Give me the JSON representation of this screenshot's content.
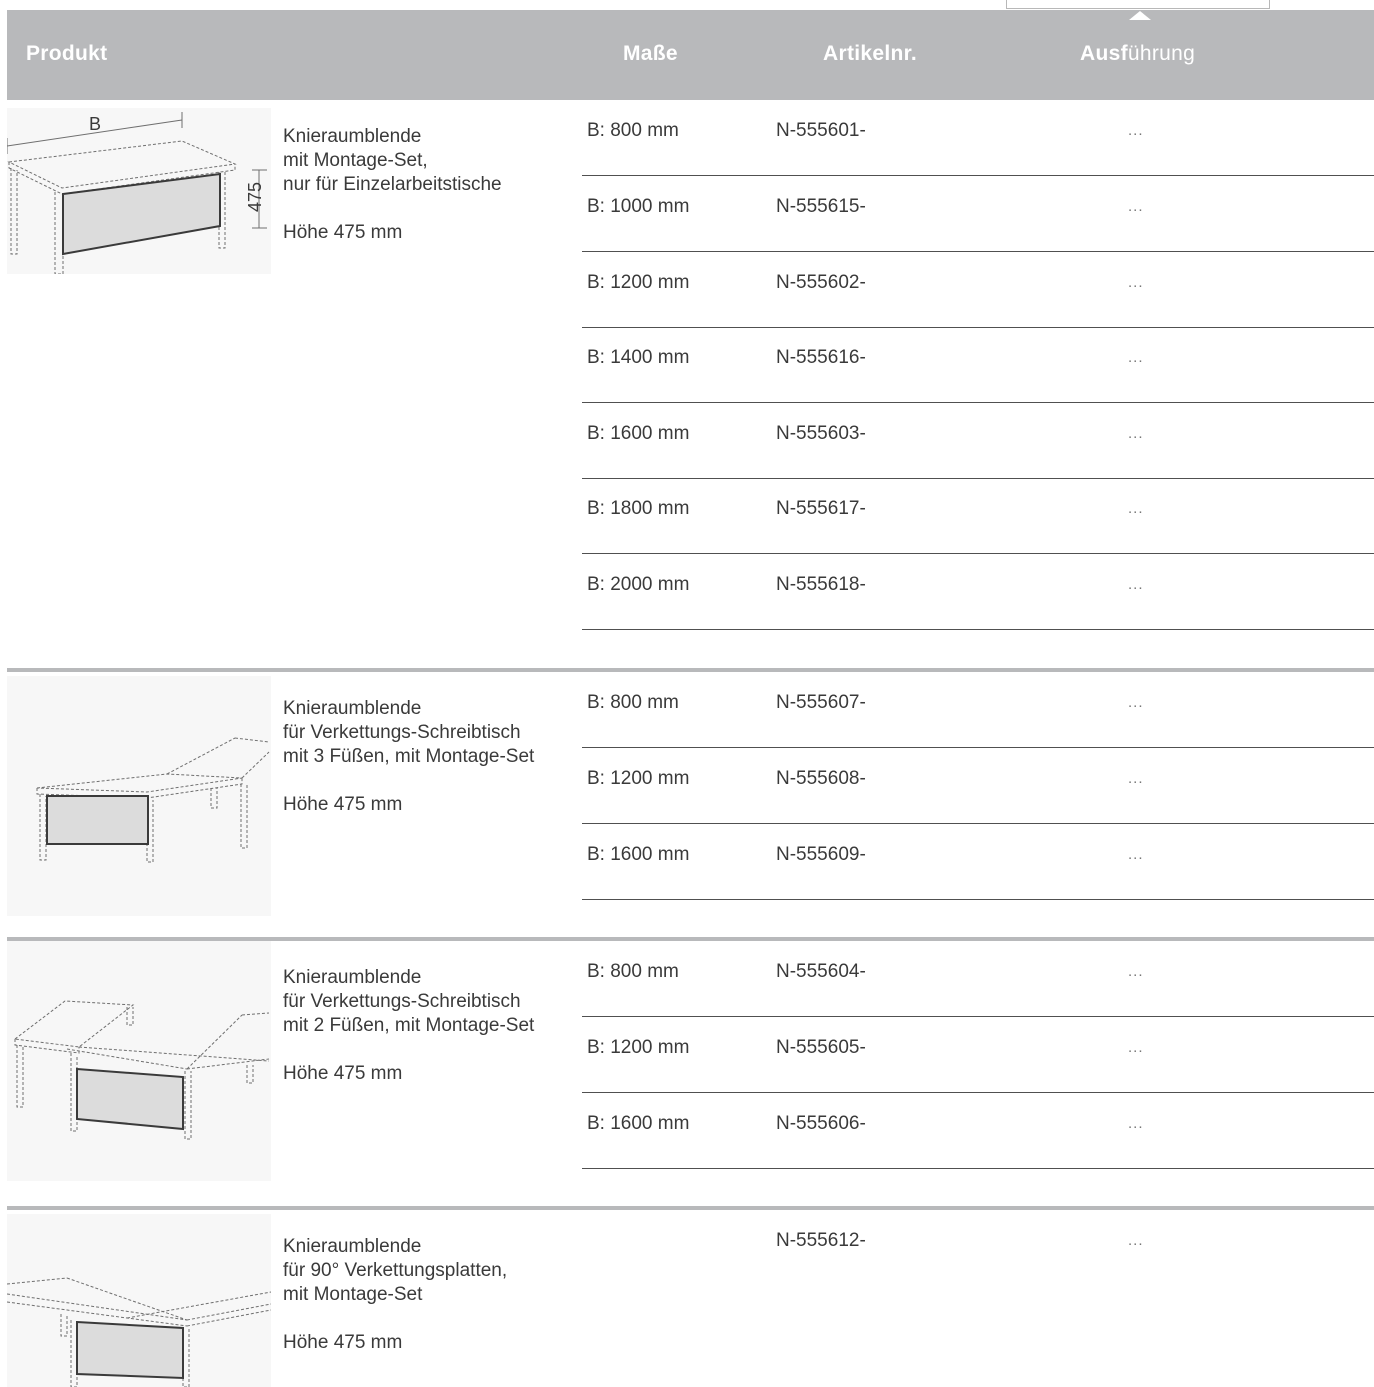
{
  "header": {
    "produkt": "Produkt",
    "masse": "Maße",
    "artikelnr": "Artikelnr.",
    "ausfuehrung_bold": "Ausf",
    "ausfuehrung_light": "ührung"
  },
  "colors": {
    "header_bg": "#b8b9bb",
    "panel_fill": "#dcdcdc",
    "divider": "#505050"
  },
  "sections": [
    {
      "desc": [
        "Knieraumblende",
        "mit Montage-Set,",
        "nur für Einzelarbeitstische",
        "",
        "Höhe 475 mm"
      ],
      "dim_width_label": "B",
      "dim_height_label": "475",
      "rows": [
        {
          "masse": "B: 800 mm",
          "artikel": "N-555601-",
          "ausf": "..."
        },
        {
          "masse": "B: 1000 mm",
          "artikel": "N-555615-",
          "ausf": "..."
        },
        {
          "masse": "B: 1200 mm",
          "artikel": "N-555602-",
          "ausf": "..."
        },
        {
          "masse": "B: 1400 mm",
          "artikel": "N-555616-",
          "ausf": "..."
        },
        {
          "masse": "B: 1600 mm",
          "artikel": "N-555603-",
          "ausf": "..."
        },
        {
          "masse": "B: 1800 mm",
          "artikel": "N-555617-",
          "ausf": "..."
        },
        {
          "masse": "B: 2000 mm",
          "artikel": "N-555618-",
          "ausf": "..."
        }
      ]
    },
    {
      "desc": [
        "Knieraumblende",
        "für Verkettungs-Schreibtisch",
        "mit 3 Füßen, mit Montage-Set",
        "",
        "Höhe 475 mm"
      ],
      "rows": [
        {
          "masse": "B: 800 mm",
          "artikel": "N-555607-",
          "ausf": "..."
        },
        {
          "masse": "B: 1200 mm",
          "artikel": "N-555608-",
          "ausf": "..."
        },
        {
          "masse": "B: 1600 mm",
          "artikel": "N-555609-",
          "ausf": "..."
        }
      ]
    },
    {
      "desc": [
        "Knieraumblende",
        "für Verkettungs-Schreibtisch",
        "mit 2 Füßen, mit Montage-Set",
        "",
        "Höhe 475 mm"
      ],
      "rows": [
        {
          "masse": "B: 800 mm",
          "artikel": "N-555604-",
          "ausf": "..."
        },
        {
          "masse": "B: 1200 mm",
          "artikel": "N-555605-",
          "ausf": "..."
        },
        {
          "masse": "B: 1600 mm",
          "artikel": "N-555606-",
          "ausf": "..."
        }
      ]
    },
    {
      "desc": [
        "Knieraumblende",
        "für 90° Verkettungsplatten,",
        "mit Montage-Set",
        "",
        "Höhe 475 mm"
      ],
      "rows": [
        {
          "masse": "",
          "artikel": "N-555612-",
          "ausf": "..."
        }
      ]
    }
  ]
}
